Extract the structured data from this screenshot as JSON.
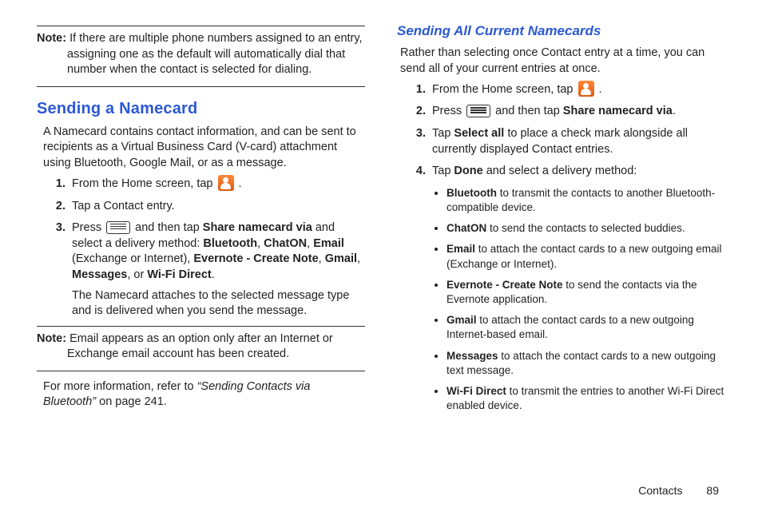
{
  "left": {
    "note1": {
      "label": "Note:",
      "text": "If there are multiple phone numbers assigned to an entry, assigning one as the default will automatically dial that number when the contact is selected for dialing."
    },
    "h2": "Sending a Namecard",
    "intro": "A Namecard contains contact information, and can be sent to recipients as a Virtual Business Card (V-card) attachment using Bluetooth, Google Mail, or as a message.",
    "step1_a": "From the Home screen, tap ",
    "step1_b": ".",
    "step2": "Tap a Contact entry.",
    "step3_a": "Press ",
    "step3_b": " and then tap ",
    "step3_bold1": "Share namecard via",
    "step3_c": " and select a delivery method: ",
    "step3_bt": "Bluetooth",
    "step3_sep": ", ",
    "step3_chaton": "ChatON",
    "step3_email": "Email",
    "step3_email_note": " (Exchange or Internet), ",
    "step3_ever": "Evernote - Create Note",
    "step3_gmail": "Gmail",
    "step3_msgs": "Messages",
    "step3_or": ", or ",
    "step3_wifi": "Wi-Fi Direct",
    "step3_end": ".",
    "step3_cont": "The Namecard attaches to the selected message type and is delivered when you send the message.",
    "note2": {
      "label": "Note:",
      "text": "Email appears as an option only after an Internet or Exchange email account has been created."
    },
    "xref_a": "For more information, refer to ",
    "xref_title": "“Sending Contacts via Bluetooth”",
    "xref_b": "  on page 241."
  },
  "right": {
    "h3": "Sending All Current Namecards",
    "intro": "Rather than selecting once Contact entry at a time, you can send all of your current entries at once.",
    "step1_a": "From the Home screen, tap ",
    "step1_b": ".",
    "step2_a": "Press ",
    "step2_b": " and then tap ",
    "step2_bold": "Share namecard via",
    "step2_c": ".",
    "step3_a": "Tap ",
    "step3_bold": "Select all",
    "step3_b": " to place a check mark alongside all currently displayed Contact entries.",
    "step4_a": "Tap ",
    "step4_bold": "Done",
    "step4_b": " and select a delivery method:",
    "bul": {
      "bt_b": "Bluetooth",
      "bt": " to transmit the contacts to another Bluetooth-compatible device.",
      "co_b": "ChatON",
      "co": " to send the contacts to selected buddies.",
      "em_b": "Email",
      "em": " to attach the contact cards to a new outgoing email (Exchange or Internet).",
      "ev_b": "Evernote - Create Note",
      "ev": " to send the contacts via the Evernote application.",
      "gm_b": "Gmail",
      "gm": " to attach the contact cards to a new outgoing Internet-based email.",
      "ms_b": "Messages",
      "ms": " to attach the contact cards to a new outgoing text message.",
      "wf_b": "Wi-Fi Direct",
      "wf": " to transmit the entries to another Wi-Fi Direct enabled device."
    }
  },
  "footer": {
    "section": "Contacts",
    "page": "89"
  }
}
